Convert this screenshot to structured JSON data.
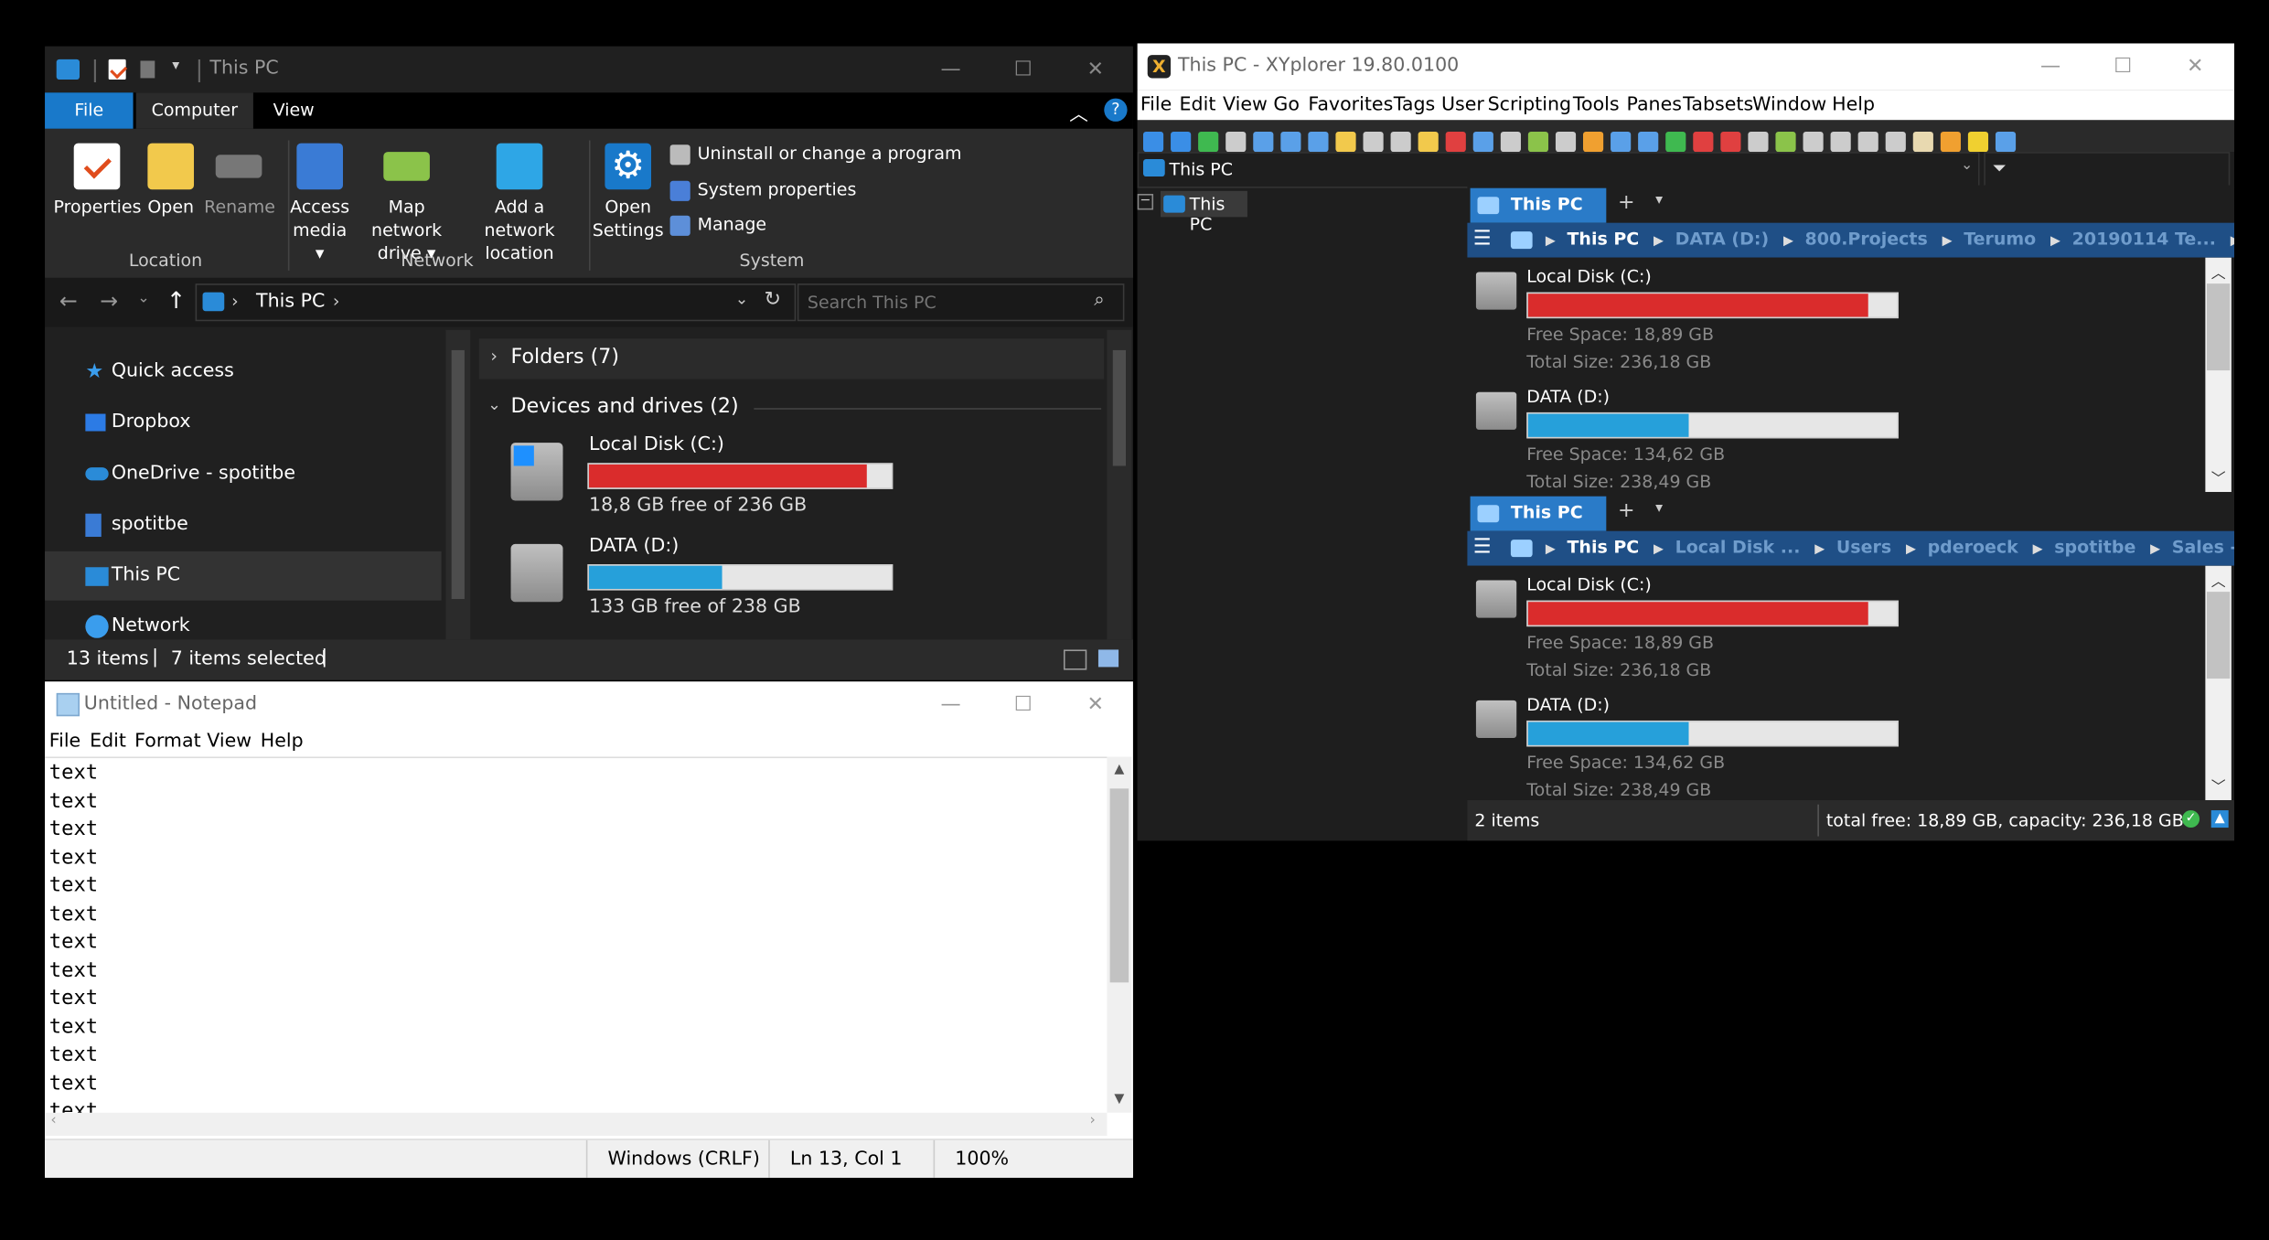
{
  "explorer": {
    "title": "This PC",
    "tabs": {
      "file": "File",
      "computer": "Computer",
      "view": "View"
    },
    "ribbon": {
      "properties": "Properties",
      "open": "Open",
      "rename": "Rename",
      "access_media": "Access media",
      "map_network": "Map network drive",
      "add_network": "Add a network location",
      "open_settings": "Open Settings",
      "uninstall": "Uninstall or change a program",
      "system_properties": "System properties",
      "manage": "Manage",
      "group_location": "Location",
      "group_network": "Network",
      "group_system": "System"
    },
    "address": "This PC",
    "search_placeholder": "Search This PC",
    "nav": [
      "Quick access",
      "Dropbox",
      "OneDrive - spotitbe",
      "spotitbe",
      "This PC",
      "Network"
    ],
    "groups": {
      "folders": "Folders (7)",
      "devices": "Devices and drives (2)"
    },
    "drives": [
      {
        "name": "Local Disk (C:)",
        "info": "18,8 GB free of 236 GB",
        "used_fraction": 0.92,
        "color": "#da2c2c"
      },
      {
        "name": "DATA (D:)",
        "info": "133 GB free of 238 GB",
        "used_fraction": 0.44,
        "color": "#26a0da"
      }
    ],
    "status": {
      "items": "13 items",
      "selected": "7 items selected"
    }
  },
  "notepad": {
    "title": "Untitled - Notepad",
    "menu": [
      "File",
      "Edit",
      "Format",
      "View",
      "Help"
    ],
    "lines": [
      "text",
      "text",
      "text",
      "text",
      "text",
      "text",
      "text",
      "text",
      "text",
      "text",
      "text",
      "text",
      "text"
    ],
    "status": {
      "encoding": "Windows (CRLF)",
      "position": "Ln 13, Col 1",
      "zoom": "100%"
    }
  },
  "xyplorer": {
    "title": "This PC - XYplorer 19.80.0100",
    "menu": [
      "File",
      "Edit",
      "View",
      "Go",
      "Favorites",
      "Tags",
      "User",
      "Scripting",
      "Tools",
      "Panes",
      "Tabsets",
      "Window",
      "Help"
    ],
    "address": "This PC",
    "tree_item": "This PC",
    "pane1": {
      "tab": "This PC",
      "breadcrumb": [
        "This PC",
        "DATA (D:)",
        "800.Projects",
        "Terumo",
        "20190114 Te...",
        "O"
      ],
      "drives": [
        {
          "name": "Local Disk (C:)",
          "free": "Free Space: 18,89 GB",
          "total": "Total Size: 236,18 GB",
          "used_fraction": 0.92,
          "color": "#da2c2c"
        },
        {
          "name": "DATA (D:)",
          "free": "Free Space: 134,62 GB",
          "total": "Total Size: 238,49 GB",
          "used_fraction": 0.435,
          "color": "#26a0da"
        }
      ]
    },
    "pane2": {
      "tab": "This PC",
      "breadcrumb": [
        "This PC",
        "Local Disk ...",
        "Users",
        "pderoeck",
        "spotitbe",
        "Sales - Ma"
      ],
      "drives": [
        {
          "name": "Local Disk (C:)",
          "free": "Free Space: 18,89 GB",
          "total": "Total Size: 236,18 GB",
          "used_fraction": 0.92,
          "color": "#da2c2c"
        },
        {
          "name": "DATA (D:)",
          "free": "Free Space: 134,62 GB",
          "total": "Total Size: 238,49 GB",
          "used_fraction": 0.435,
          "color": "#26a0da"
        }
      ]
    },
    "status": {
      "items": "2 items",
      "info": "total free: 18,89 GB, capacity: 236,18 GB"
    }
  }
}
